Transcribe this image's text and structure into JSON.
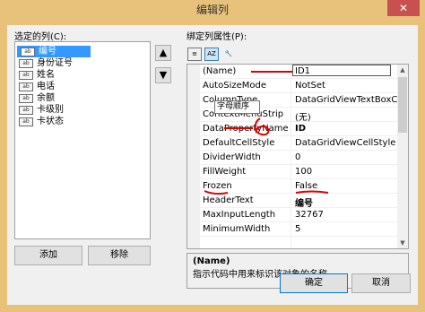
{
  "window": {
    "title": "编辑列",
    "close_glyph": "✕"
  },
  "left": {
    "label": "选定的列(C):",
    "columns": [
      {
        "label": "编号",
        "icon": "ab"
      },
      {
        "label": "身份证号",
        "icon": "ab"
      },
      {
        "label": "姓名",
        "icon": "ab"
      },
      {
        "label": "电话",
        "icon": "ab"
      },
      {
        "label": "余额",
        "icon": "ab"
      },
      {
        "label": "卡级别",
        "icon": "ab"
      },
      {
        "label": "卡状态",
        "icon": "ab"
      }
    ],
    "move_up": "▲",
    "move_down": "▼",
    "add_label": "添加",
    "remove_label": "移除"
  },
  "right": {
    "label": "绑定列属性(P):",
    "toolbar": {
      "categorized": "≡",
      "alphabetical": "AZ",
      "property_pages": "🔧"
    },
    "tooltip": "字母顺序",
    "properties": [
      {
        "name": "(Name)",
        "value": "ID1"
      },
      {
        "name": "AutoSizeMode",
        "value": "NotSet"
      },
      {
        "name": "ColumnType",
        "value": "DataGridViewTextBoxColu"
      },
      {
        "name": "ContextMenuStrip",
        "value": "(无)"
      },
      {
        "name": "DataPropertyName",
        "value": "ID"
      },
      {
        "name": "DefaultCellStyle",
        "value": "DataGridViewCellStyle { }"
      },
      {
        "name": "DividerWidth",
        "value": "0"
      },
      {
        "name": "FillWeight",
        "value": "100"
      },
      {
        "name": "Frozen",
        "value": "False"
      },
      {
        "name": "HeaderText",
        "value": "编号"
      },
      {
        "name": "MaxInputLength",
        "value": "32767"
      },
      {
        "name": "MinimumWidth",
        "value": "5"
      }
    ],
    "description": {
      "title": "(Name)",
      "text": "指示代码中用来标识该对象的名称。"
    }
  },
  "buttons": {
    "ok": "确定",
    "cancel": "取消"
  }
}
